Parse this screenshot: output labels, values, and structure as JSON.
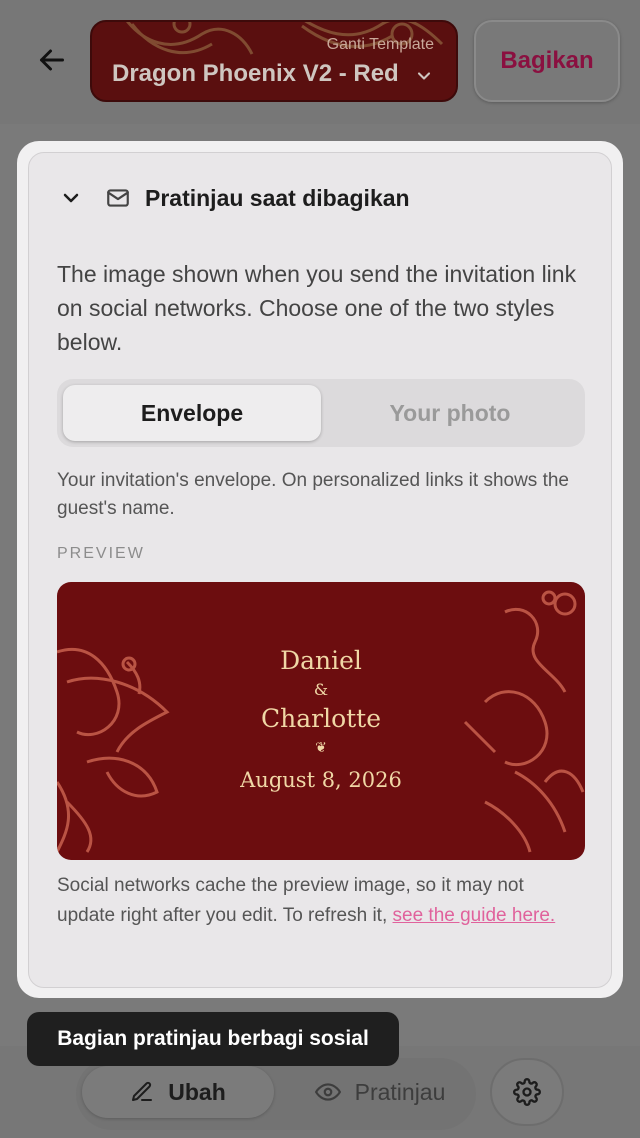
{
  "header": {
    "template_caption": "Ganti Template",
    "template_name": "Dragon Phoenix V2 - Red",
    "share_label": "Bagikan"
  },
  "section": {
    "title": "Pratinjau saat dibagikan",
    "description": "The image shown when you send the invitation link on social networks. Choose one of the two styles below.",
    "options": [
      {
        "label": "Envelope",
        "selected": true
      },
      {
        "label": "Your photo",
        "selected": false
      }
    ],
    "option_help": "Your invitation's envelope. On personalized links it shows the guest's name.",
    "preview_label": "PREVIEW",
    "preview_card": {
      "name1": "Daniel",
      "ampersand": "&",
      "name2": "Charlotte",
      "ornament": "❦",
      "date": "August 8, 2026"
    },
    "footnote_text": "Social networks cache the preview image, so it may not update right after you edit. To refresh it, ",
    "footnote_link": "see the guide here."
  },
  "tooltip": "Bagian pratinjau berbagi sosial",
  "bottom_bar": {
    "edit_label": "Ubah",
    "preview_label": "Pratinjau"
  },
  "colors": {
    "card_bg": "#6c0d0f",
    "card_text": "#f0d7a6",
    "card_art": "#c8614e",
    "share_text": "#8a1040",
    "link": "#e0629c"
  }
}
